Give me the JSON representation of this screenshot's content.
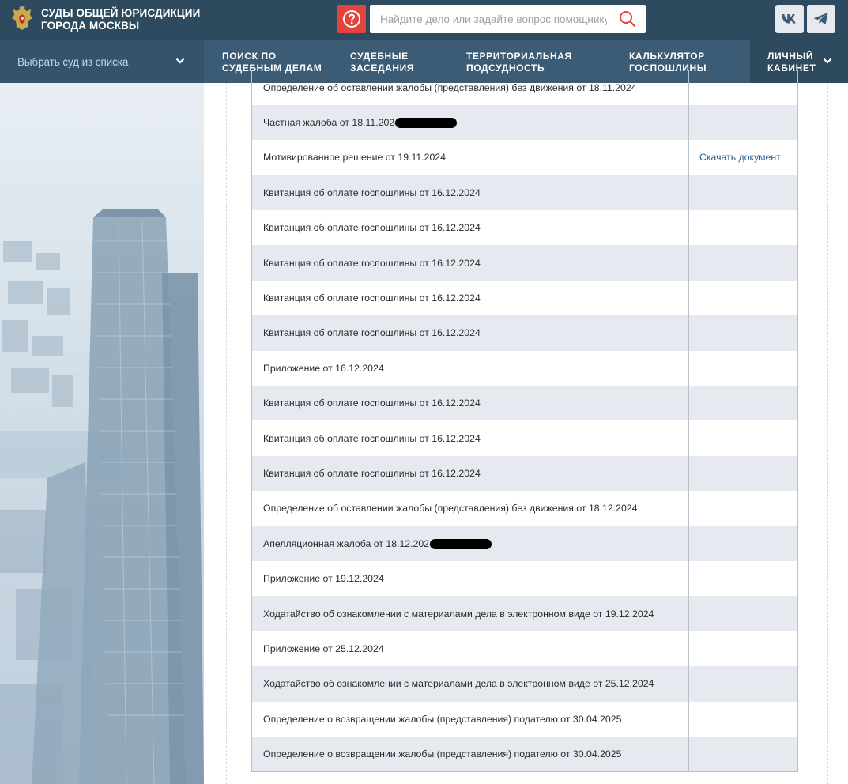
{
  "header": {
    "logo_line1": "СУДЫ ОБЩЕЙ ЮРИСДИКЦИИ",
    "logo_line2": "ГОРОДА МОСКВЫ",
    "help_icon": "question-circle-icon",
    "search_placeholder": "Найдите дело или задайте вопрос помощнику",
    "search_icon": "search-icon",
    "social": [
      "vk-icon",
      "telegram-icon"
    ]
  },
  "nav": {
    "court_select": "Выбрать суд из списка",
    "items": [
      {
        "line1": "ПОИСК ПО",
        "line2": "СУДЕБНЫМ ДЕЛАМ"
      },
      {
        "line1": "СУДЕБНЫЕ",
        "line2": "ЗАСЕДАНИЯ"
      },
      {
        "line1": "ТЕРРИТОРИАЛЬНАЯ",
        "line2": "ПОДСУДНОСТЬ"
      },
      {
        "line1": "КАЛЬКУЛЯТОР",
        "line2": "ГОСПОШЛИНЫ"
      }
    ],
    "cabinet": {
      "line1": "ЛИЧНЫЙ",
      "line2": "КАБИНЕТ"
    }
  },
  "documents": [
    {
      "name": "Определение об оставлении жалобы (представления) без движения от 18.11.2024",
      "action": ""
    },
    {
      "name": "Частная жалоба от 18.11.2024",
      "action": ""
    },
    {
      "name": "Мотивированное решение от 19.11.2024",
      "action": "Скачать документ"
    },
    {
      "name": "Квитанция об оплате госпошлины от 16.12.2024",
      "action": ""
    },
    {
      "name": "Квитанция об оплате госпошлины от 16.12.2024",
      "action": ""
    },
    {
      "name": "Квитанция об оплате госпошлины от 16.12.2024",
      "action": ""
    },
    {
      "name": "Квитанция об оплате госпошлины от 16.12.2024",
      "action": ""
    },
    {
      "name": "Квитанция об оплате госпошлины от 16.12.2024",
      "action": ""
    },
    {
      "name": "Приложение от 16.12.2024",
      "action": ""
    },
    {
      "name": "Квитанция об оплате госпошлины от 16.12.2024",
      "action": ""
    },
    {
      "name": "Квитанция об оплате госпошлины от 16.12.2024",
      "action": ""
    },
    {
      "name": "Квитанция об оплате госпошлины от 16.12.2024",
      "action": ""
    },
    {
      "name": "Определение об оставлении жалобы (представления) без движения от 18.12.2024",
      "action": ""
    },
    {
      "name": "Апелляционная жалоба от 18.12.2024",
      "action": ""
    },
    {
      "name": "Приложение от 19.12.2024",
      "action": ""
    },
    {
      "name": "Ходатайство об ознакомлении с материалами дела в электронном виде от 19.12.2024",
      "action": ""
    },
    {
      "name": "Приложение от 25.12.2024",
      "action": ""
    },
    {
      "name": "Ходатайство об ознакомлении с материалами дела в электронном виде от 25.12.2024",
      "action": ""
    },
    {
      "name": "Определение о возвращении жалобы (представления) подателю от 30.04.2025",
      "action": ""
    },
    {
      "name": "Определение о возвращении жалобы (представления) подателю от 30.04.2025",
      "action": ""
    }
  ],
  "colors": {
    "header_bg": "#2e4a5f",
    "nav_bg": "#3c5b74",
    "help_red": "#e5423b",
    "row_alt": "#e6eaf0",
    "link": "#2b5f8e"
  }
}
